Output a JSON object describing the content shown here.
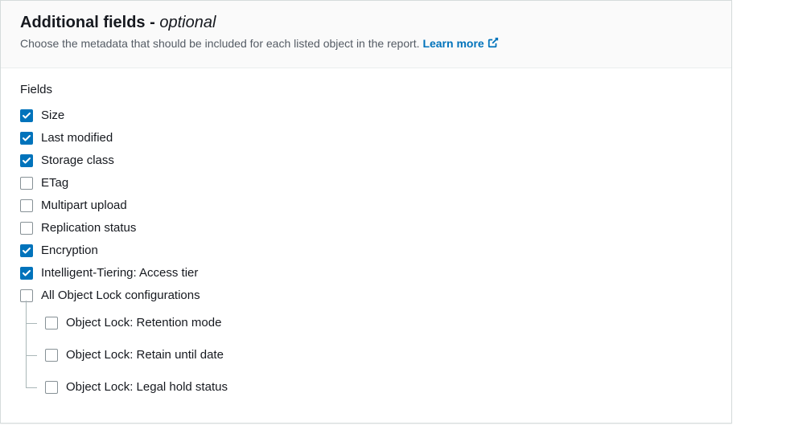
{
  "header": {
    "title_main": "Additional fields",
    "title_separator": " - ",
    "title_secondary": "optional",
    "subtitle": "Choose the metadata that should be included for each listed object in the report. ",
    "learn_more": "Learn more"
  },
  "fields": {
    "label": "Fields",
    "items": [
      {
        "id": "size",
        "label": "Size",
        "checked": true
      },
      {
        "id": "last-modified",
        "label": "Last modified",
        "checked": true
      },
      {
        "id": "storage-class",
        "label": "Storage class",
        "checked": true
      },
      {
        "id": "etag",
        "label": "ETag",
        "checked": false
      },
      {
        "id": "multipart-upload",
        "label": "Multipart upload",
        "checked": false
      },
      {
        "id": "replication-status",
        "label": "Replication status",
        "checked": false
      },
      {
        "id": "encryption",
        "label": "Encryption",
        "checked": true
      },
      {
        "id": "intelligent-tiering",
        "label": "Intelligent-Tiering: Access tier",
        "checked": true
      },
      {
        "id": "object-lock-all",
        "label": "All Object Lock configurations",
        "checked": false
      }
    ],
    "nested": [
      {
        "id": "object-lock-retention-mode",
        "label": "Object Lock: Retention mode",
        "checked": false
      },
      {
        "id": "object-lock-retain-until",
        "label": "Object Lock: Retain until date",
        "checked": false
      },
      {
        "id": "object-lock-legal-hold",
        "label": "Object Lock: Legal hold status",
        "checked": false
      }
    ]
  }
}
